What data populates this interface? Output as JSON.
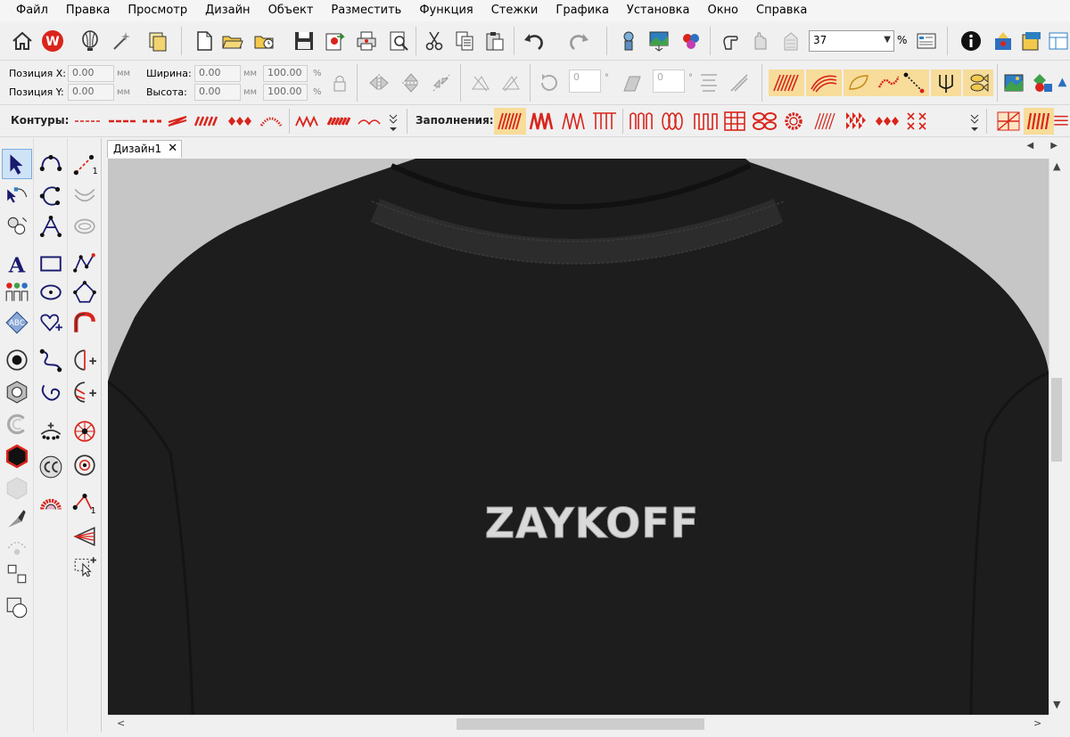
{
  "menu": [
    "Файл",
    "Правка",
    "Просмотр",
    "Дизайн",
    "Объект",
    "Разместить",
    "Функция",
    "Стежки",
    "Графика",
    "Установка",
    "Окно",
    "Справка"
  ],
  "toolbar": {
    "zoom_value": "37",
    "zoom_unit": "%"
  },
  "props": {
    "pos_x_label": "Позиция X:",
    "pos_y_label": "Позиция Y:",
    "width_label": "Ширина:",
    "height_label": "Высота:",
    "pos_x": "0.00",
    "pos_y": "0.00",
    "width": "0.00",
    "height": "0.00",
    "width_pct": "100.00",
    "height_pct": "100.00",
    "unit_mm": "мм",
    "unit_pct": "%",
    "angle1": "0",
    "angle2": "0",
    "deg": "°"
  },
  "strips": {
    "contours_label": "Контуры:",
    "fills_label": "Заполнения:"
  },
  "document": {
    "tab_label": "Дизайн1",
    "close_glyph": "✕",
    "tab_nav": "◀ ▶",
    "embroidery_text": "ZAYKOFF"
  },
  "colors": {
    "accent_red": "#d9241c",
    "canvas_bg": "#c6c6c6",
    "shirt": "#1c1c1c",
    "selection": "#cfe3f7"
  },
  "scroll": {
    "left_arrow": "<",
    "right_arrow": ">",
    "up_arrow": "▲",
    "down_arrow": "▼"
  }
}
